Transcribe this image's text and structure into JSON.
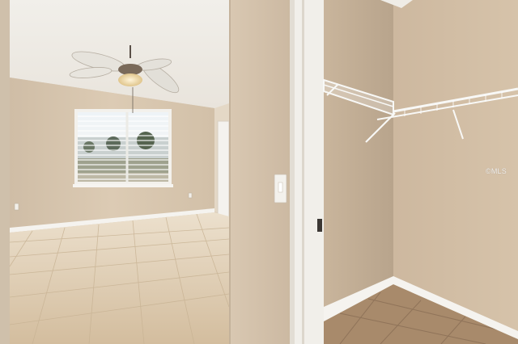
{
  "photo": {
    "watermark": "©MLS"
  },
  "colors": {
    "wall_warm": "#d8c8b2",
    "wall_shadow": "#b9a894",
    "ceiling": "#f4f1ec",
    "floor_tile": "#d9c4a6",
    "closet_floor": "#a98a6c",
    "trim_white": "#f7f5f1",
    "grout": "#bba588"
  }
}
